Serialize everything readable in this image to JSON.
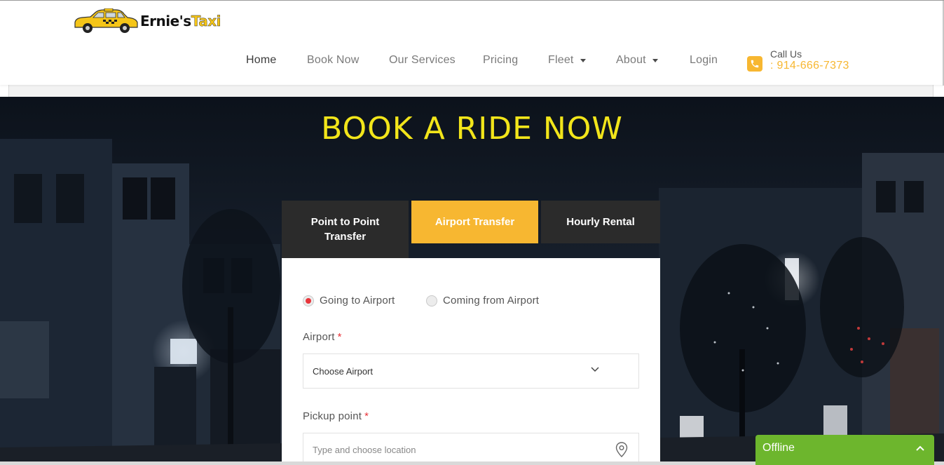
{
  "brand": {
    "name_part1": "Ernie's",
    "name_part2": "Taxi",
    "accent": "#f7b731",
    "title_color": "#f2e51a"
  },
  "nav": {
    "items": [
      {
        "label": "Home",
        "active": true
      },
      {
        "label": "Book Now"
      },
      {
        "label": "Our Services"
      },
      {
        "label": "Pricing"
      },
      {
        "label": "Fleet",
        "dropdown": true
      },
      {
        "label": "About",
        "dropdown": true
      },
      {
        "label": "Login"
      }
    ]
  },
  "call": {
    "label": "Call Us",
    "number": ": 914-666-7373",
    "icon": "phone-icon"
  },
  "hero": {
    "title": "BOOK A RIDE NOW"
  },
  "booking": {
    "tabs": [
      {
        "label": "Point to Point Transfer"
      },
      {
        "label": "Airport Transfer",
        "active": true
      },
      {
        "label": "Hourly Rental"
      }
    ],
    "direction_options": [
      {
        "label": "Going to Airport",
        "checked": true
      },
      {
        "label": "Coming from Airport",
        "checked": false
      }
    ],
    "airport": {
      "label": "Airport",
      "required_mark": "*",
      "value": "Choose Airport",
      "icon": "chevron-down-icon"
    },
    "pickup": {
      "label": "Pickup point",
      "required_mark": "*",
      "placeholder": "Type and choose location",
      "icon": "map-pin-icon"
    }
  },
  "chat": {
    "status": "Offline",
    "status_color": "#6db62d",
    "icon": "chevron-up-icon"
  }
}
